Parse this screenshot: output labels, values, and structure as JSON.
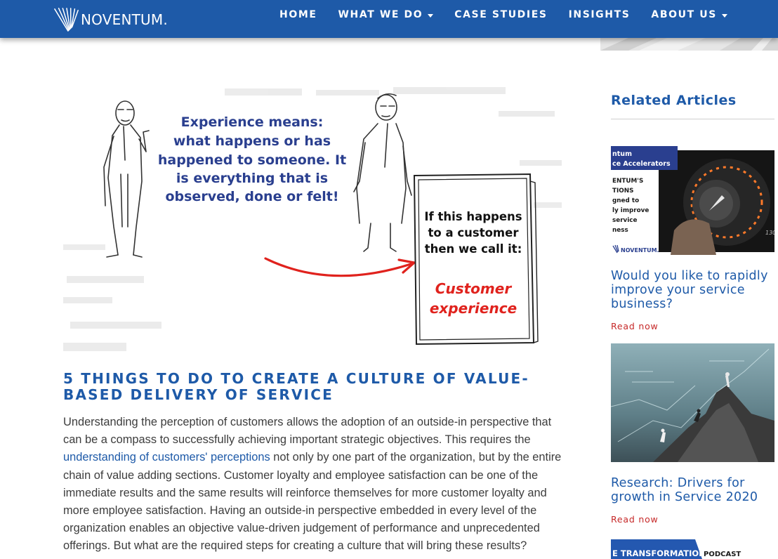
{
  "brand": {
    "name": "NOVENTUM."
  },
  "nav": {
    "items": [
      {
        "label": "HOME",
        "dropdown": false
      },
      {
        "label": "WHAT WE DO",
        "dropdown": true
      },
      {
        "label": "CASE STUDIES",
        "dropdown": false
      },
      {
        "label": "INSIGHTS",
        "dropdown": false
      },
      {
        "label": "ABOUT US",
        "dropdown": true
      }
    ]
  },
  "illustration": {
    "speech": [
      "Experience means:",
      "what happens or has",
      "happened to someone. It",
      "is everything that is",
      "observed, done or felt!"
    ],
    "card_text": [
      "If this happens",
      "to a customer",
      "then we call it:"
    ],
    "card_highlight": [
      "Customer",
      "experience"
    ]
  },
  "article": {
    "title": "5 THINGS TO DO TO CREATE A CULTURE OF VALUE-BASED DELIVERY OF SERVICE",
    "body_before_link": "Understanding the perception of customers allows the adoption of an outside-in perspective that can be a compass to successfully achieving important strategic objectives. This requires the ",
    "link_text": "understanding of customers' perceptions",
    "body_after_link": " not only by one part of the organization, but by the entire chain of value adding sections. Customer loyalty and employee satisfaction can be one of the immediate results and the same results will reinforce themselves for more customer loyalty and more employee satisfaction. Having an outside-in perspective embedded in every level of the organization enables an objective value-driven judgement of performance and unprecedented offerings. But what are the required steps for creating a culture that will bring these results?"
  },
  "sidebar": {
    "heading": "Related Articles",
    "cards": [
      {
        "title": "Would you like to rapidly improve your service business?",
        "link": "Read now",
        "thumb_text": {
          "banner_1": "ntum",
          "banner_2": "ce Accelerators",
          "lines": [
            "ENTUM'S",
            "TIONS",
            "gned to",
            "ly improve",
            "service",
            "ness"
          ],
          "logo": "NOVENTUM.",
          "gauge_number": "130"
        }
      },
      {
        "title": "Research: Drivers for growth in Service 2020",
        "link": "Read now"
      },
      {
        "thumb_text": {
          "banner_left": "E TRANSFORMATION",
          "banner_right": "PODCAST"
        }
      }
    ]
  },
  "colors": {
    "brand_blue": "#1e5aa8",
    "link_red": "#c62828",
    "highlight_red": "#e0221d",
    "navy": "#2a3f8f"
  },
  "icons": {
    "logo_mark": "noventum-fan-icon",
    "dropdown": "caret-down-icon"
  }
}
